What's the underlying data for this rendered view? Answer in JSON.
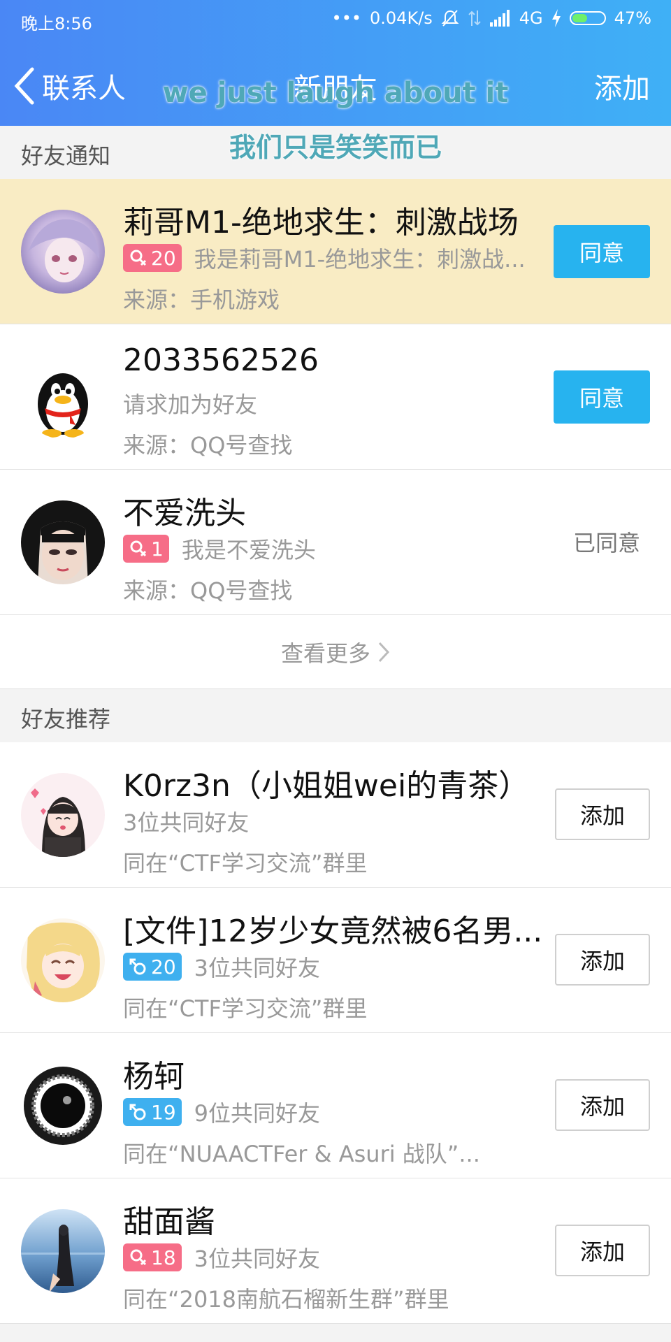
{
  "status_bar": {
    "time": "晚上8:56",
    "network_speed": "0.04K/s",
    "network_type": "4G",
    "battery": "47%",
    "battery_level": 0.47
  },
  "nav": {
    "back_label": "联系人",
    "title": "新朋友",
    "add_label": "添加"
  },
  "subtitles": {
    "english": "we just laugh about it",
    "chinese": "我们只是笑笑而已"
  },
  "notifications": {
    "section_title": "好友通知",
    "items": [
      {
        "name": "莉哥M1-绝地求生：刺激战场",
        "badge": "20",
        "badge_gender": "female",
        "message": "我是莉哥M1-绝地求生：刺激战...",
        "source": "来源：手机游戏",
        "action": "同意"
      },
      {
        "name": "2033562526",
        "message": "请求加为好友",
        "source": "来源：QQ号查找",
        "action": "同意"
      },
      {
        "name": "不爱洗头",
        "badge": "1",
        "badge_gender": "female",
        "message": "我是不爱洗头",
        "source": "来源：QQ号查找",
        "status": "已同意"
      }
    ],
    "more_label": "查看更多"
  },
  "recommendations": {
    "section_title": "好友推荐",
    "items": [
      {
        "name": "K0rz3n（小姐姐wei的青茶）",
        "mutual": "3位共同好友",
        "group": "同在“CTF学习交流”群里",
        "action": "添加"
      },
      {
        "name": "[文件]12岁少女竟然被6名男...",
        "badge": "20",
        "badge_gender": "male",
        "mutual": "3位共同好友",
        "group": "同在“CTF学习交流”群里",
        "action": "添加"
      },
      {
        "name": "杨轲",
        "badge": "19",
        "badge_gender": "male",
        "mutual": "9位共同好友",
        "group": "同在“NUAACTFer & Asuri 战队”...",
        "action": "添加"
      },
      {
        "name": "甜面酱",
        "badge": "18",
        "badge_gender": "female",
        "mutual": "3位共同好友",
        "group": "同在“2018南航石榴新生群”群里",
        "action": "添加"
      }
    ]
  },
  "colors": {
    "header_start": "#4a87f5",
    "header_end": "#3fb0f6",
    "agree_button": "#27b3ef",
    "highlight_row": "#f9ecc4",
    "female_badge": "#f66d87",
    "male_badge": "#3fb0ef"
  }
}
